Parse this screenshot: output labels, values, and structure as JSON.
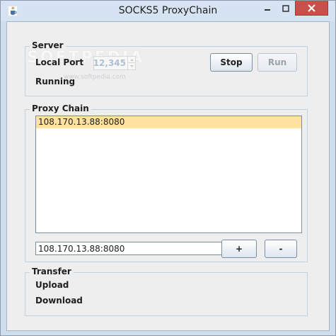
{
  "window": {
    "title": "SOCKS5 ProxyChain"
  },
  "server": {
    "group_title": "Server",
    "local_port_label": "Local Port",
    "local_port_value": "12,345",
    "status_label": "Running",
    "stop_label": "Stop",
    "run_label": "Run"
  },
  "proxy_chain": {
    "group_title": "Proxy Chain",
    "items": [
      "108.170.13.88:8080"
    ],
    "selected_index": 0,
    "input_value": "108.170.13.88:8080",
    "add_label": "+",
    "remove_label": "-"
  },
  "transfer": {
    "group_title": "Transfer",
    "upload_label": "Upload",
    "download_label": "Download"
  },
  "watermark": {
    "text": "SOFTPEDIA",
    "sub": "www.softpedia.com"
  },
  "colors": {
    "selection": "#ffe1a0",
    "close_button": "#c7504a",
    "titlebar": "#d6e3f2"
  }
}
